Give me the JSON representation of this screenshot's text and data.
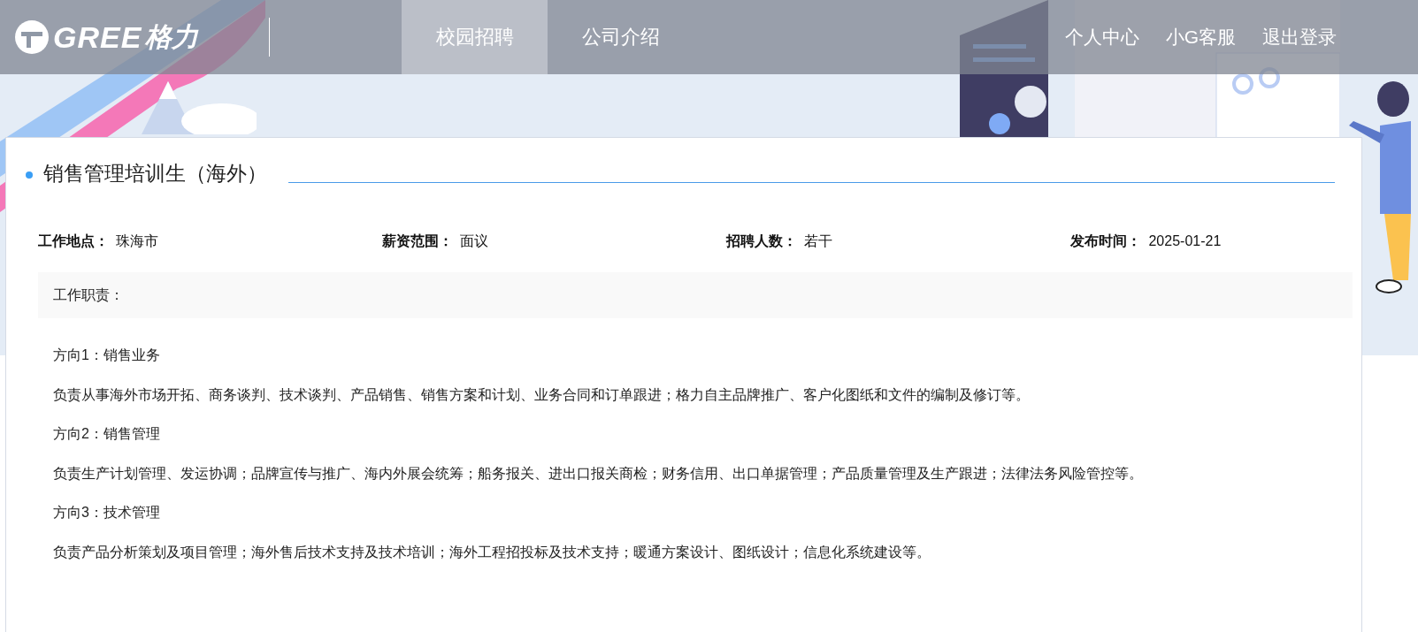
{
  "header": {
    "logo": {
      "latin": "GREE",
      "chinese": "格力"
    },
    "nav_tabs": [
      {
        "label": "校园招聘",
        "selected": true
      },
      {
        "label": "公司介绍",
        "selected": false
      }
    ],
    "user_links": [
      "个人中心",
      "小G客服",
      "退出登录"
    ]
  },
  "job": {
    "title": "销售管理培训生（海外）",
    "info": [
      {
        "label": "工作地点：",
        "value": "珠海市"
      },
      {
        "label": "薪资范围：",
        "value": "面议"
      },
      {
        "label": "招聘人数：",
        "value": "若干"
      },
      {
        "label": "发布时间：",
        "value": "2025-01-21"
      }
    ],
    "section_heading": "工作职责：",
    "paragraphs": [
      "方向1：销售业务",
      "负责从事海外市场开拓、商务谈判、技术谈判、产品销售、销售方案和计划、业务合同和订单跟进；格力自主品牌推广、客户化图纸和文件的编制及修订等。",
      "方向2：销售管理",
      "负责生产计划管理、发运协调；品牌宣传与推广、海内外展会统筹；船务报关、进出口报关商检；财务信用、出口单据管理；产品质量管理及生产跟进；法律法务风险管控等。",
      "方向3：技术管理",
      "负责产品分析策划及项目管理；海外售后技术支持及技术培训；海外工程招投标及技术支持；暖通方案设计、图纸设计；信息化系统建设等。"
    ]
  }
}
